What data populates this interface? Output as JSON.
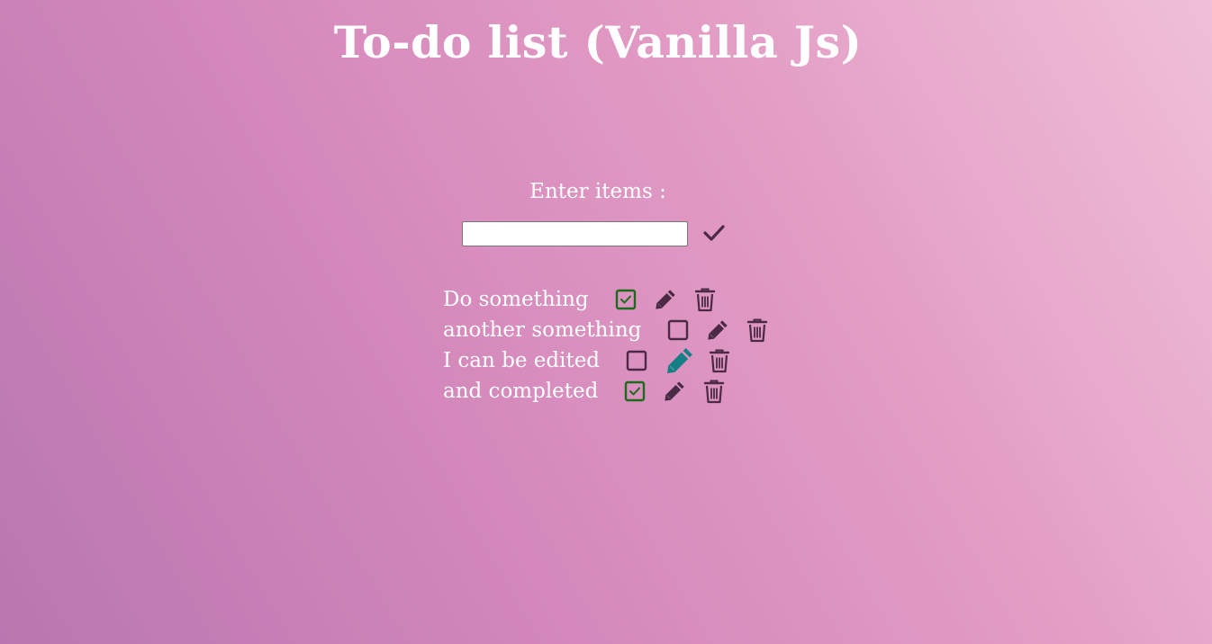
{
  "header": {
    "title": "To-do list (Vanilla Js)"
  },
  "form": {
    "label": "Enter items :",
    "input_value": "",
    "input_placeholder": "",
    "submit_icon": "check-icon"
  },
  "todos": [
    {
      "text": "Do something",
      "completed": true,
      "editing": false
    },
    {
      "text": "another something",
      "completed": false,
      "editing": false
    },
    {
      "text": "I can be edited",
      "completed": false,
      "editing": true
    },
    {
      "text": "and completed",
      "completed": true,
      "editing": false
    }
  ],
  "icons": {
    "checkbox": "checkbox-icon",
    "edit": "pencil-icon",
    "delete": "trash-icon"
  },
  "colors": {
    "icon": "#4a2a45",
    "completed_check": "#1b6b1b",
    "editing_pencil": "#167f85",
    "text": "#ffffff"
  }
}
